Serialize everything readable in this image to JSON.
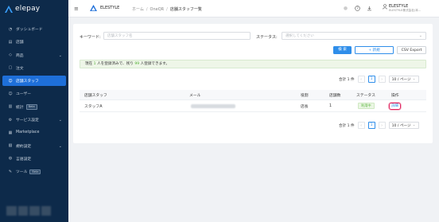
{
  "brand": {
    "name": "elepay",
    "color": "#1e6fd9"
  },
  "sidebar": {
    "items": [
      {
        "label": "ダッシュボード",
        "icon": "dashboard-icon",
        "glyph": "◔"
      },
      {
        "label": "店舗",
        "icon": "store-icon",
        "glyph": "▤"
      },
      {
        "label": "商品",
        "icon": "tag-icon",
        "glyph": "◇",
        "expandable": true
      },
      {
        "label": "注文",
        "icon": "bag-icon",
        "glyph": "▢"
      },
      {
        "label": "店舗スタッフ",
        "icon": "user-icon",
        "glyph": "☺",
        "active": true
      },
      {
        "label": "ユーザー",
        "icon": "users-icon",
        "glyph": "☺"
      },
      {
        "label": "統計",
        "icon": "chart-icon",
        "glyph": "▥",
        "badge": "Beta"
      },
      {
        "label": "サービス設定",
        "icon": "gear-icon",
        "glyph": "⚙",
        "expandable": true
      },
      {
        "label": "Marketplace",
        "icon": "grid-icon",
        "glyph": "▦"
      },
      {
        "label": "規約設定",
        "icon": "document-icon",
        "glyph": "▧",
        "expandable": true
      },
      {
        "label": "言語設定",
        "icon": "globe-icon",
        "glyph": "◍"
      },
      {
        "label": "ツール",
        "icon": "wrench-icon",
        "glyph": "✎",
        "badge": "Beta"
      }
    ]
  },
  "header": {
    "app_name": "ELESTYLE",
    "breadcrumb": [
      "ホーム",
      "OneQR",
      "店舗スタッフ一覧"
    ],
    "user_name": "ELESTYLE",
    "user_sub": "ELESTYLE株式会社(本..."
  },
  "filters": {
    "keyword_label": "キーワード:",
    "keyword_placeholder": "店舗スタッフ名",
    "status_label": "ステータス:",
    "status_placeholder": "選択してください"
  },
  "actions": {
    "search": "検 索",
    "add": "+ 新規",
    "export": "CSV Export"
  },
  "notice": {
    "prefix": "現在",
    "count": "1",
    "middle": "人を登録済みで、残り",
    "remaining": "99",
    "suffix": "人登録できます。"
  },
  "pagination": {
    "total": "合計 1 件",
    "page": "1",
    "page_size": "10 / ページ"
  },
  "table": {
    "headers": [
      "店舗スタッフ",
      "メール",
      "役割",
      "店舗数",
      "ステータス",
      "操作"
    ],
    "rows": [
      {
        "name": "スタッフA",
        "role": "店長",
        "stores": "1",
        "status": "利用中",
        "action": "詳細"
      }
    ]
  }
}
